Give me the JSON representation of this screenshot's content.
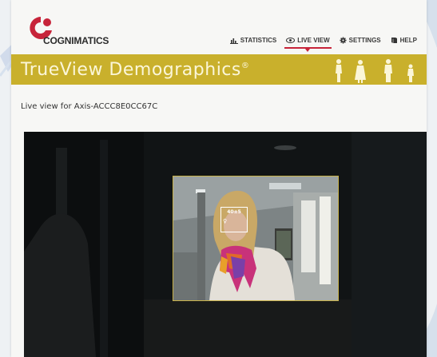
{
  "brand": {
    "name": "COGNIMATICS",
    "accent": "#c7243a",
    "banner_color": "#c9b02c"
  },
  "nav": {
    "items": [
      {
        "label": "STATISTICS",
        "icon": "bar-chart-icon",
        "active": false
      },
      {
        "label": "LIVE VIEW",
        "icon": "eye-icon",
        "active": true
      },
      {
        "label": "SETTINGS",
        "icon": "gear-icon",
        "active": false
      },
      {
        "label": "HELP",
        "icon": "book-icon",
        "active": false
      }
    ]
  },
  "banner": {
    "title": "TrueView Demographics",
    "mark": "®"
  },
  "caption": "Live view for Axis-ACCC8E0CC67C",
  "detection": {
    "age_label": "40±5",
    "gender_symbol": "♀"
  }
}
